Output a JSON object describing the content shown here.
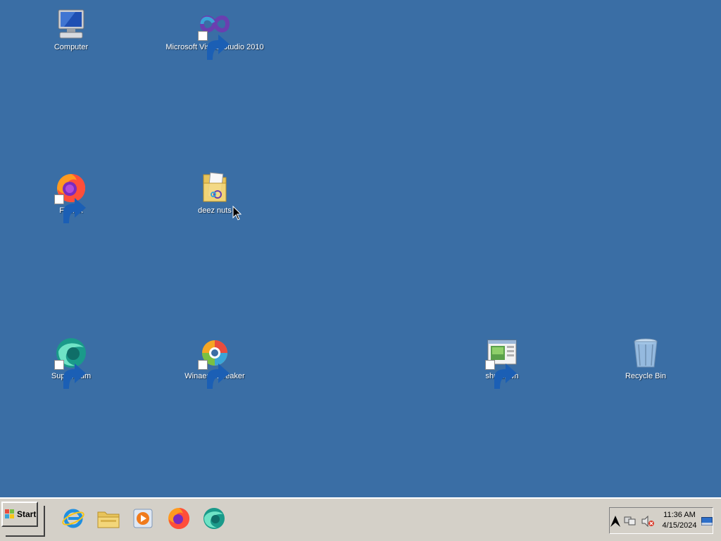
{
  "desktop": {
    "background_color": "#3a6ea5",
    "icons": [
      {
        "label": "Computer",
        "icon": "computer-icon",
        "shortcut": false
      },
      {
        "label": "Microsoft Visual Studio 2010",
        "icon": "visual-studio-icon",
        "shortcut": true
      },
      {
        "label": "Firefox",
        "icon": "firefox-icon",
        "shortcut": true
      },
      {
        "label": "deez nuts",
        "icon": "folder-icon",
        "shortcut": false
      },
      {
        "label": "Supermium",
        "icon": "supermium-icon",
        "shortcut": true
      },
      {
        "label": "Winaero Tweaker",
        "icon": "winaero-tweaker-icon",
        "shortcut": true
      },
      {
        "label": "shutdown",
        "icon": "shutdown-app-icon",
        "shortcut": true
      },
      {
        "label": "Recycle Bin",
        "icon": "recycle-bin-icon",
        "shortcut": false
      }
    ]
  },
  "taskbar": {
    "start_label": "Start",
    "quick_launch": [
      {
        "icon": "internet-explorer-icon"
      },
      {
        "icon": "file-explorer-icon"
      },
      {
        "icon": "media-player-icon"
      },
      {
        "icon": "firefox-icon"
      },
      {
        "icon": "supermium-icon"
      }
    ],
    "tray": {
      "icons": [
        "show-hidden-icons-arrow",
        "network-icon",
        "volume-muted-icon",
        "show-desktop-icon"
      ],
      "time": "11:36 AM",
      "date": "4/15/2024"
    }
  }
}
